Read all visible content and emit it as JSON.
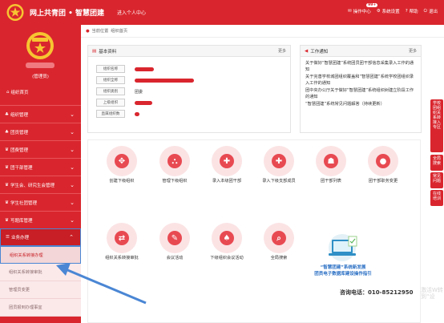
{
  "header": {
    "title": "网上共青团 • 智慧团建",
    "enter_personal": "进入个人中心",
    "actions": [
      {
        "label": "操作中心",
        "icon": "envelope-icon"
      },
      {
        "label": "系统设置",
        "icon": "gear-icon"
      },
      {
        "label": "帮助",
        "icon": "help-icon"
      },
      {
        "label": "退出",
        "icon": "power-icon"
      }
    ],
    "badge": "99+"
  },
  "sidebar": {
    "user_role": "(管理员)",
    "home_label": "组织首页",
    "menu": [
      {
        "label": "组织管理",
        "icon": "org-icon"
      },
      {
        "label": "团员管理",
        "icon": "member-icon"
      },
      {
        "label": "团费管理",
        "icon": "fee-icon"
      },
      {
        "label": "团干部管理",
        "icon": "cadre-icon"
      },
      {
        "label": "学生会、研究生会管理",
        "icon": "student-icon"
      },
      {
        "label": "学生社团管理",
        "icon": "club-icon"
      },
      {
        "label": "写题库管理",
        "icon": "bank-icon"
      },
      {
        "label": "业务办理",
        "icon": "business-icon"
      }
    ],
    "submenu": [
      {
        "label": "组织关系转接办理"
      },
      {
        "label": "组织关系转接审批"
      },
      {
        "label": "管理员变更"
      },
      {
        "label": "团员报到办理事宜"
      }
    ]
  },
  "breadcrumb": {
    "prefix": "当前位置",
    "current": "组织首页"
  },
  "basic_info": {
    "title": "基本资料",
    "more": "更多",
    "rows": [
      {
        "label": "组织名称",
        "value": ""
      },
      {
        "label": "组织全称",
        "value": ""
      },
      {
        "label": "组织类别",
        "value": "团委"
      },
      {
        "label": "上级组织",
        "value": ""
      },
      {
        "label": "直属组织数",
        "value": ""
      }
    ]
  },
  "notices": {
    "title": "工作通知",
    "more": "更多",
    "items": [
      "关于做好“智慧团建”系统团员团干部信息采集录入工作的通知",
      "关于完善学校城团组织覆盖和“智慧团建”系统学校团组织录入工作的通知",
      "团中央办公厅关于做好“智慧团建”系统组织树建立阶段工作的通知",
      "“智慧团建”系统常见问题解答（持续更新）"
    ]
  },
  "float_tabs": [
    "学校团组织关系转接入专区",
    "全局搜索",
    "常见问题",
    "在线培训"
  ],
  "functions": [
    {
      "label": "创建下级组织",
      "icon": "move-icon"
    },
    {
      "label": "管理下级组织",
      "icon": "sitemap-icon"
    },
    {
      "label": "录入本级团干部",
      "icon": "plus-square-icon"
    },
    {
      "label": "录入下级支部成员",
      "icon": "plus-square-icon"
    },
    {
      "label": "团干部列表",
      "icon": "users-icon"
    },
    {
      "label": "团干部职务变更",
      "icon": "user-icon"
    },
    {
      "label": "组织关系转接审批",
      "icon": "retweet-icon"
    },
    {
      "label": "会议活动",
      "icon": "edit-icon"
    },
    {
      "label": "下级组织会议活动",
      "icon": "tree-icon"
    },
    {
      "label": "全局搜索",
      "icon": "search-icon"
    }
  ],
  "promo": {
    "line1": "“智慧团建”系统新发展",
    "line2": "团员电子数据库建设操作指引"
  },
  "contact": {
    "phone": "咨询电话：010-85212950"
  },
  "watermark": "激活W转到“设"
}
